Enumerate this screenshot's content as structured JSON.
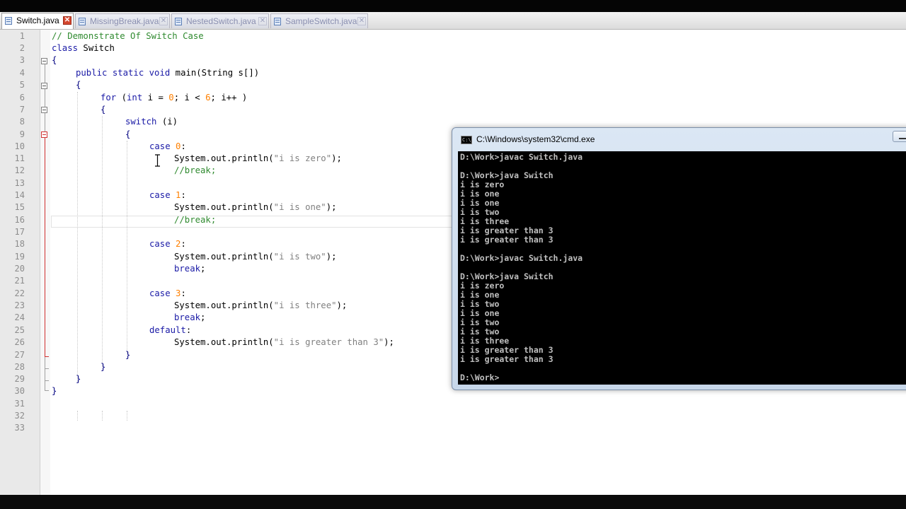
{
  "tabs": [
    {
      "label": "Switch.java",
      "active": true
    },
    {
      "label": "MissingBreak.java",
      "active": false
    },
    {
      "label": "NestedSwitch.java",
      "active": false
    },
    {
      "label": "SampleSwitch.java",
      "active": false
    }
  ],
  "editor": {
    "line_numbers": [
      "1",
      "2",
      "3",
      "4",
      "5",
      "6",
      "7",
      "8",
      "9",
      "10",
      "11",
      "12",
      "13",
      "14",
      "15",
      "16",
      "17",
      "18",
      "19",
      "20",
      "21",
      "22",
      "23",
      "24",
      "25",
      "26",
      "27",
      "28",
      "29",
      "30",
      "31",
      "32",
      "33"
    ],
    "lines": {
      "l1": "// Demonstrate Of Switch Case",
      "l2a": "class",
      "l2b": " Switch",
      "l3": "{",
      "l4a": "public static void",
      "l4b": " main(String s[])",
      "l5": "{",
      "l6a": "for",
      "l6b": " (",
      "l6c": "int",
      "l6d": " i = ",
      "l6e": "0",
      "l6f": "; i < ",
      "l6g": "6",
      "l6h": "; i++ )",
      "l7": "{",
      "l8a": "switch",
      "l8b": " (i)",
      "l9": "{",
      "l10a": "case",
      "l10b": " 0",
      "l10c": ":",
      "l11a": "System.out.println(",
      "l11b": "\"i is zero\"",
      "l11c": ");",
      "l12": "//break;",
      "l14a": "case",
      "l14b": " 1",
      "l14c": ":",
      "l15a": "System.out.println(",
      "l15b": "\"i is one\"",
      "l15c": ");",
      "l16": "//break;",
      "l18a": "case",
      "l18b": " 2",
      "l18c": ":",
      "l19a": "System.out.println(",
      "l19b": "\"i is two\"",
      "l19c": ");",
      "l20a": "break",
      "l20b": ";",
      "l22a": "case",
      "l22b": " 3",
      "l22c": ":",
      "l23a": "System.out.println(",
      "l23b": "\"i is three\"",
      "l23c": ");",
      "l24a": "break",
      "l24b": ";",
      "l25a": "default",
      "l25b": ":",
      "l26a": "System.out.println(",
      "l26b": "\"i is greater than 3\"",
      "l26c": ");",
      "l27": "}",
      "l28": "}",
      "l29": "}",
      "l30": "}"
    }
  },
  "cmd": {
    "title": "C:\\Windows\\system32\\cmd.exe",
    "icon": "C:\\",
    "output": [
      "D:\\Work>javac Switch.java",
      "",
      "D:\\Work>java Switch",
      "i is zero",
      "i is one",
      "i is one",
      "i is two",
      "i is three",
      "i is greater than 3",
      "i is greater than 3",
      "",
      "D:\\Work>javac Switch.java",
      "",
      "D:\\Work>java Switch",
      "i is zero",
      "i is one",
      "i is two",
      "i is one",
      "i is two",
      "i is two",
      "i is three",
      "i is greater than 3",
      "i is greater than 3",
      "",
      "D:\\Work>"
    ]
  },
  "colors": {
    "keyword": "#1a1aa6",
    "comment": "#2f8a2f",
    "number": "#ff8000",
    "string": "#808080"
  }
}
